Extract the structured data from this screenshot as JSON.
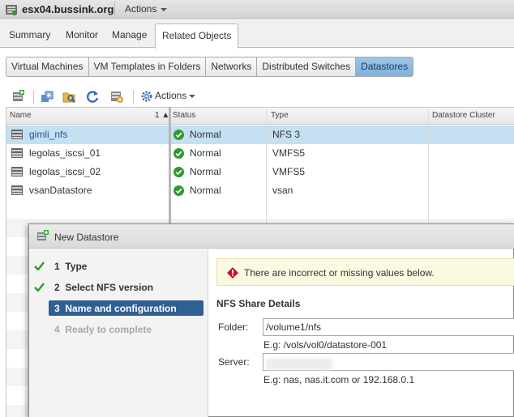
{
  "header": {
    "host_name": "esx04.bussink.org",
    "actions_label": "Actions"
  },
  "main_tabs": [
    {
      "label": "Summary",
      "active": false
    },
    {
      "label": "Monitor",
      "active": false
    },
    {
      "label": "Manage",
      "active": false
    },
    {
      "label": "Related Objects",
      "active": true
    }
  ],
  "sub_tabs": [
    {
      "label": "Virtual Machines",
      "active": false
    },
    {
      "label": "VM Templates in Folders",
      "active": false
    },
    {
      "label": "Networks",
      "active": false
    },
    {
      "label": "Distributed Switches",
      "active": false
    },
    {
      "label": "Datastores",
      "active": true
    }
  ],
  "toolbar": {
    "actions_label": "Actions",
    "icons": [
      "new-datastore-icon",
      "register-vm-icon",
      "browse-files-icon",
      "refresh-icon",
      "datastore-cluster-icon",
      "actions-gear-icon"
    ]
  },
  "grid": {
    "columns": [
      "Name",
      "Status",
      "Type",
      "Datastore Cluster"
    ],
    "sort_indicator": "1 ▲",
    "rows": [
      {
        "name": "gimli_nfs",
        "status": "Normal",
        "type": "NFS 3",
        "cluster": "",
        "selected": true
      },
      {
        "name": "legolas_iscsi_01",
        "status": "Normal",
        "type": "VMFS5",
        "cluster": "",
        "selected": false
      },
      {
        "name": "legolas_iscsi_02",
        "status": "Normal",
        "type": "VMFS5",
        "cluster": "",
        "selected": false
      },
      {
        "name": "vsanDatastore",
        "status": "Normal",
        "type": "vsan",
        "cluster": "",
        "selected": false
      }
    ]
  },
  "dialog": {
    "title": "New Datastore",
    "steps": [
      {
        "number": "1",
        "label": "Type",
        "state": "done"
      },
      {
        "number": "2",
        "label": "Select NFS version",
        "state": "done"
      },
      {
        "number": "3",
        "label": "Name and configuration",
        "state": "current"
      },
      {
        "number": "4",
        "label": "Ready to complete",
        "state": "pending"
      }
    ],
    "warning": "There are incorrect or missing values below.",
    "section_title": "NFS Share Details",
    "folder_label": "Folder:",
    "folder_value": "/volume1/nfs",
    "folder_hint": "E.g: /vols/vol0/datastore-001",
    "server_label": "Server:",
    "server_value": "",
    "server_hint": "E.g: nas, nas.it.com or 192.168.0.1"
  },
  "colors": {
    "selection": "#c5dff3",
    "active_tab": "#7fb0db",
    "current_step": "#2f5f93",
    "status_ok": "#2e9a2e",
    "warning_bg": "#fbfae0",
    "warning_icon": "#c8102e"
  }
}
